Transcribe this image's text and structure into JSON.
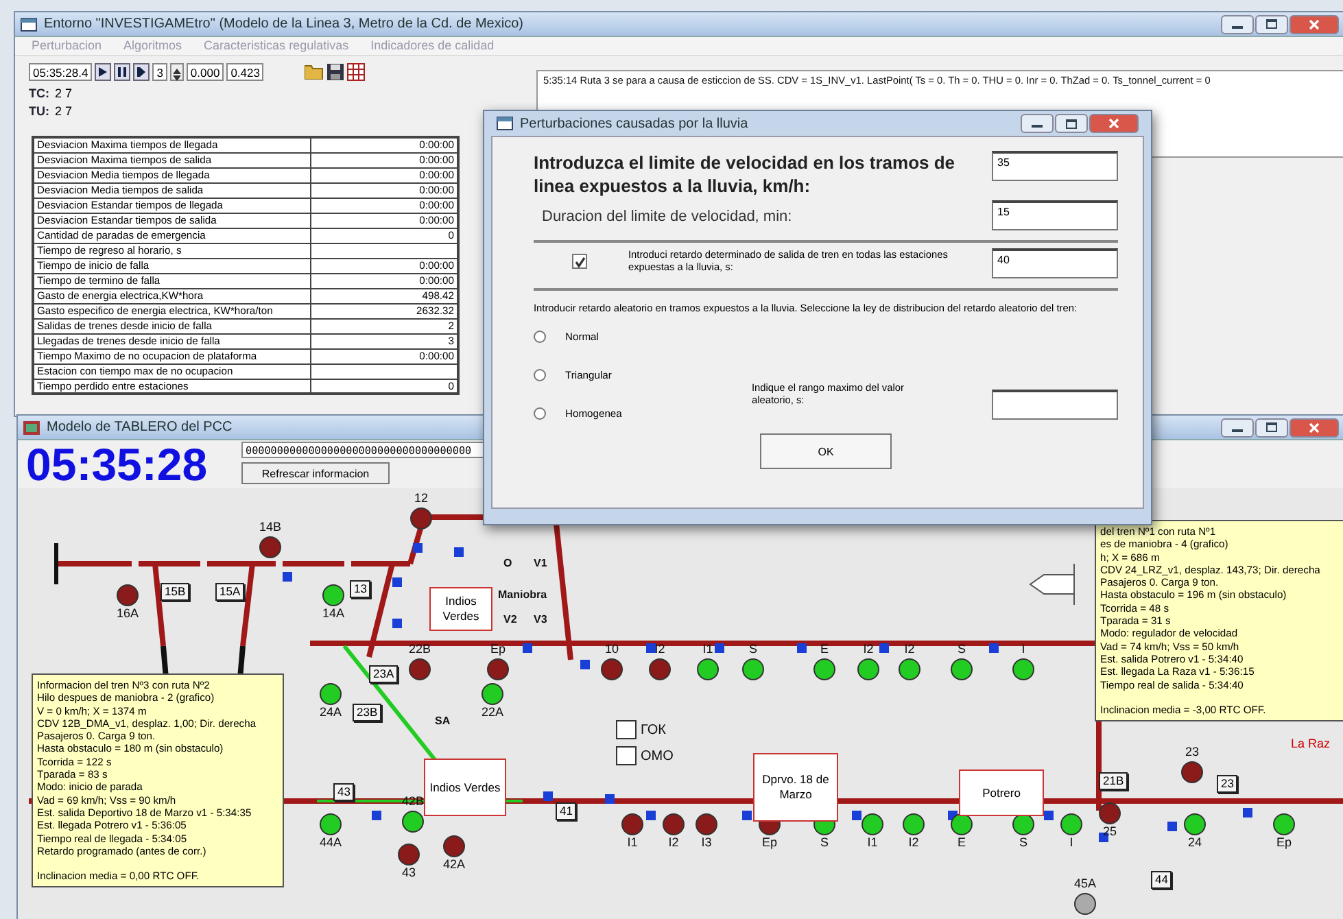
{
  "main_window": {
    "title": "Entorno \"INVESTIGAMEtro\" (Modelo de la Linea 3, Metro de la Cd. de Mexico)",
    "menu": [
      "Perturbacion",
      "Algoritmos",
      "Caracteristicas regulativas",
      "Indicadores de calidad"
    ],
    "toolbar": {
      "time": "05:35:28.4",
      "step": "3",
      "value_1": "0.000",
      "value_2": "0.423"
    },
    "counters": [
      {
        "label": "TC:",
        "value": "2 7"
      },
      {
        "label": "TU:",
        "value": "2 7"
      }
    ],
    "log": "5:35:14 Ruta 3 se para a causa de esticcion de SS. CDV = 1S_INV_v1. LastPoint( Ts = 0. Th = 0. THU = 0. Inr = 0. ThZad = 0. Ts_tonnel_current = 0",
    "table": {
      "rows": [
        {
          "label": "Desviacion Maxima tiempos de llegada",
          "value": "0:00:00"
        },
        {
          "label": "Desviacion Maxima tiempos de salida",
          "value": "0:00:00"
        },
        {
          "label": "Desviacion Media tiempos de llegada",
          "value": "0:00:00"
        },
        {
          "label": "Desviacion Media tiempos de salida",
          "value": "0:00:00"
        },
        {
          "label": "Desviacion Estandar tiempos de llegada",
          "value": "0:00:00"
        },
        {
          "label": "Desviacion Estandar tiempos de salida",
          "value": "0:00:00"
        },
        {
          "label": "Cantidad de paradas de emergencia",
          "value": "0"
        },
        {
          "label": "Tiempo de regreso al horario, s"
        },
        {
          "label": "Tiempo de inicio de falla",
          "value": "0:00:00"
        },
        {
          "label": "Tiempo de termino de falla",
          "value": "0:00:00"
        },
        {
          "label": "Gasto de energia electrica,KW*hora",
          "value": "498.42"
        },
        {
          "label": "Gasto especifico de energia electrica, KW*hora/ton",
          "value": "2632.32"
        },
        {
          "label": "Salidas de trenes desde inicio de falla",
          "value": "2"
        },
        {
          "label": "Llegadas de trenes desde inicio de falla",
          "value": "3"
        },
        {
          "label": "Tiempo Maximo de no ocupacion de plataforma",
          "value": "0:00:00"
        },
        {
          "label": "Estacion con tiempo max de no ocupacion"
        },
        {
          "label": "Tiempo perdido entre estaciones",
          "value": "0"
        }
      ]
    }
  },
  "board_window": {
    "title": "Modelo de TABLERO del PCC",
    "clock": "05:35:28",
    "indicator": "000000000000000000000000000000000000",
    "refresh_button": "Refrescar informacion",
    "diagram": {
      "signals": [
        {
          "label": "16A",
          "color": "#8b1a1a"
        },
        {
          "label": "14B",
          "color": "#8b1a1a"
        },
        {
          "label": "14A",
          "color": "#22cc22"
        },
        {
          "label": "12",
          "color": "#8b1a1a"
        },
        {
          "label": "22B",
          "color": "#8b1a1a"
        },
        {
          "label": "Ep",
          "color": "#8b1a1a"
        },
        {
          "label": "10",
          "color": "#8b1a1a"
        },
        {
          "label": "I2",
          "color": "#8b1a1a"
        },
        {
          "label": "I1",
          "color": "#22cc22"
        },
        {
          "label": "S",
          "color": "#22cc22"
        },
        {
          "label": "E",
          "color": "#22cc22"
        },
        {
          "label": "I2",
          "color": "#22cc22"
        },
        {
          "label": "I2",
          "color": "#22cc22"
        },
        {
          "label": "S",
          "color": "#22cc22"
        },
        {
          "label": "I",
          "color": "#22cc22"
        },
        {
          "label": "24A",
          "color": "#22cc22"
        },
        {
          "label": "22A",
          "color": "#22cc22"
        },
        {
          "label": "44A",
          "color": "#22cc22"
        },
        {
          "label": "43",
          "color": "#8b1a1a"
        },
        {
          "label": "42A",
          "color": "#8b1a1a"
        },
        {
          "label": "I1",
          "color": "#8b1a1a"
        },
        {
          "label": "I2",
          "color": "#8b1a1a"
        },
        {
          "label": "I3",
          "color": "#8b1a1a"
        },
        {
          "label": "Ep",
          "color": "#8b1a1a"
        },
        {
          "label": "S",
          "color": "#22cc22"
        },
        {
          "label": "I1",
          "color": "#22cc22"
        },
        {
          "label": "I2",
          "color": "#22cc22"
        },
        {
          "label": "E",
          "color": "#22cc22"
        },
        {
          "label": "S",
          "color": "#22cc22"
        },
        {
          "label": "I",
          "color": "#22cc22"
        },
        {
          "label": "25",
          "color": "#8b1a1a"
        },
        {
          "label": "24",
          "color": "#22cc22"
        },
        {
          "label": "Ep",
          "color": "#22cc22"
        },
        {
          "label": "23",
          "color": "#8b1a1a"
        },
        {
          "label": "45A",
          "color": "#aaaaaa"
        },
        {
          "label": "42B",
          "color": "#22cc22"
        }
      ],
      "track_boxes": [
        "15B",
        "15A",
        "13",
        "23A",
        "23B",
        "43",
        "41",
        "21B",
        "23",
        "44"
      ],
      "stations": [
        "Indios Verdes",
        "Indios Verdes",
        "Dprvo. 18 de Marzo",
        "Potrero"
      ],
      "labels": [
        {
          "text": "O",
          "kind": "mark"
        },
        {
          "text": "V1",
          "kind": "mark"
        },
        {
          "text": "Maniobra",
          "kind": "mark"
        },
        {
          "text": "V2",
          "kind": "mark"
        },
        {
          "text": "V3",
          "kind": "mark"
        },
        {
          "text": "SA",
          "kind": "mark"
        },
        {
          "text": "ГОК",
          "kind": "indicator"
        },
        {
          "text": "ОМО",
          "kind": "indicator"
        },
        {
          "text": "La Raz",
          "kind": "station"
        }
      ]
    },
    "train_info": [
      {
        "lines": [
          "Informacion del tren Nº3 con ruta Nº2",
          "Hilo despues de maniobra - 2 (grafico)",
          "V = 0 km/h; X = 1374 m",
          "CDV 12B_DMA_v1, desplaz. 1,00; Dir. derecha",
          "Pasajeros 0. Carga 9 ton.",
          "Hasta obstaculo = 180 m (sin obstaculo)",
          "Tcorrida = 122 s",
          "Tparada = 83 s",
          "Modo: inicio de parada",
          "Vad = 69 km/h; Vss = 90 km/h",
          "Est. salida Deportivo 18 de Marzo v1 - 5:34:35",
          "Est. llegada Potrero v1 - 5:36:05",
          "Tiempo real de llegada - 5:34:05",
          "Retardo programado (antes de corr.)"
        ],
        "footer": "Inclinacion media = 0,00 RTC OFF."
      },
      {
        "lines": [
          "del tren Nº1 con ruta Nº1",
          "es de maniobra - 4 (grafico)",
          "h; X = 686 m",
          "CDV 24_LRZ_v1, desplaz. 143,73; Dir. derecha",
          "Pasajeros 0. Carga 9 ton.",
          "Hasta obstaculo = 196 m (sin obstaculo)",
          "Tcorrida = 48 s",
          "Tparada = 31 s",
          "Modo: regulador de velocidad",
          "Vad = 74 km/h; Vss = 50 km/h",
          "Est. salida Potrero v1 - 5:34:40",
          "Est. llegada La Raza v1 - 5:36:15",
          "Tiempo real de salida - 5:34:40"
        ],
        "footer": "Inclinacion media = -3,00 RTC OFF."
      }
    ]
  },
  "dialog": {
    "title": "Perturbaciones causadas por la lluvia",
    "speed_label": "Introduzca el limite de velocidad en los tramos de linea expuestos a la lluvia, km/h:",
    "speed_value": "35",
    "duration_label": "Duracion del limite de velocidad, min:",
    "duration_value": "15",
    "delay_checkbox": {
      "checked": true,
      "label": "Introduci retardo determinado de salida de tren en todas las estaciones expuestas a la lluvia, s:",
      "value": "40"
    },
    "random_text": "Introducir retardo aleatorio en tramos expuestos a la lluvia. Seleccione la ley de distribucion del retardo aleatorio del tren:",
    "distributions": [
      {
        "label": "Normal",
        "selected": false
      },
      {
        "label": "Triangular",
        "selected": false
      },
      {
        "label": "Homogenea",
        "selected": false
      }
    ],
    "range_label": "Indique el rango maximo del valor aleatorio, s:",
    "ok_button": "OK"
  }
}
